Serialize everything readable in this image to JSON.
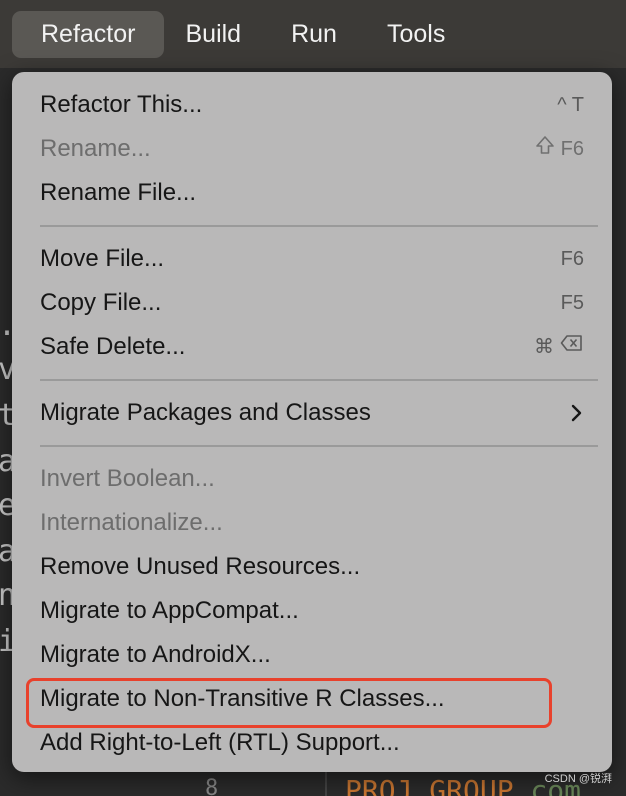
{
  "menubar": {
    "items": [
      {
        "label": "Refactor",
        "active": true
      },
      {
        "label": "Build",
        "active": false
      },
      {
        "label": "Run",
        "active": false
      },
      {
        "label": "Tools",
        "active": false
      }
    ]
  },
  "dropdown": {
    "groups": [
      [
        {
          "label": "Refactor This...",
          "shortcut": "^ T",
          "disabled": false
        },
        {
          "label": "Rename...",
          "shortcut": "F6",
          "shortcut_icon": "shift-icon",
          "disabled": true
        },
        {
          "label": "Rename File...",
          "shortcut": "",
          "disabled": false
        }
      ],
      [
        {
          "label": "Move File...",
          "shortcut": "F6",
          "disabled": false
        },
        {
          "label": "Copy File...",
          "shortcut": "F5",
          "disabled": false
        },
        {
          "label": "Safe Delete...",
          "shortcut": "⌘",
          "shortcut_icon": "delete-key-icon",
          "disabled": false
        }
      ],
      [
        {
          "label": "Migrate Packages and Classes",
          "submenu": true,
          "disabled": false
        }
      ],
      [
        {
          "label": "Invert Boolean...",
          "disabled": true
        },
        {
          "label": "Internationalize...",
          "disabled": true
        },
        {
          "label": "Remove Unused Resources...",
          "disabled": false
        },
        {
          "label": "Migrate to AppCompat...",
          "disabled": false
        },
        {
          "label": "Migrate to AndroidX...",
          "disabled": false
        },
        {
          "label": "Migrate to Non-Transitive R Classes...",
          "disabled": false,
          "highlighted": true
        },
        {
          "label": "Add Right-to-Left (RTL) Support...",
          "disabled": false
        }
      ]
    ]
  },
  "editor": {
    "gutter_chars": [
      ".",
      "v",
      "t",
      "a",
      "e",
      "a",
      "n",
      "i"
    ],
    "line_number": "8",
    "code_keyword": "PROJ_GROUP",
    "code_tail": " com"
  },
  "watermark": "CSDN @锐湃",
  "colors": {
    "highlight_border": "#e8412c",
    "menu_background": "#b9b8b8",
    "menubar_background": "#3c3a37"
  }
}
